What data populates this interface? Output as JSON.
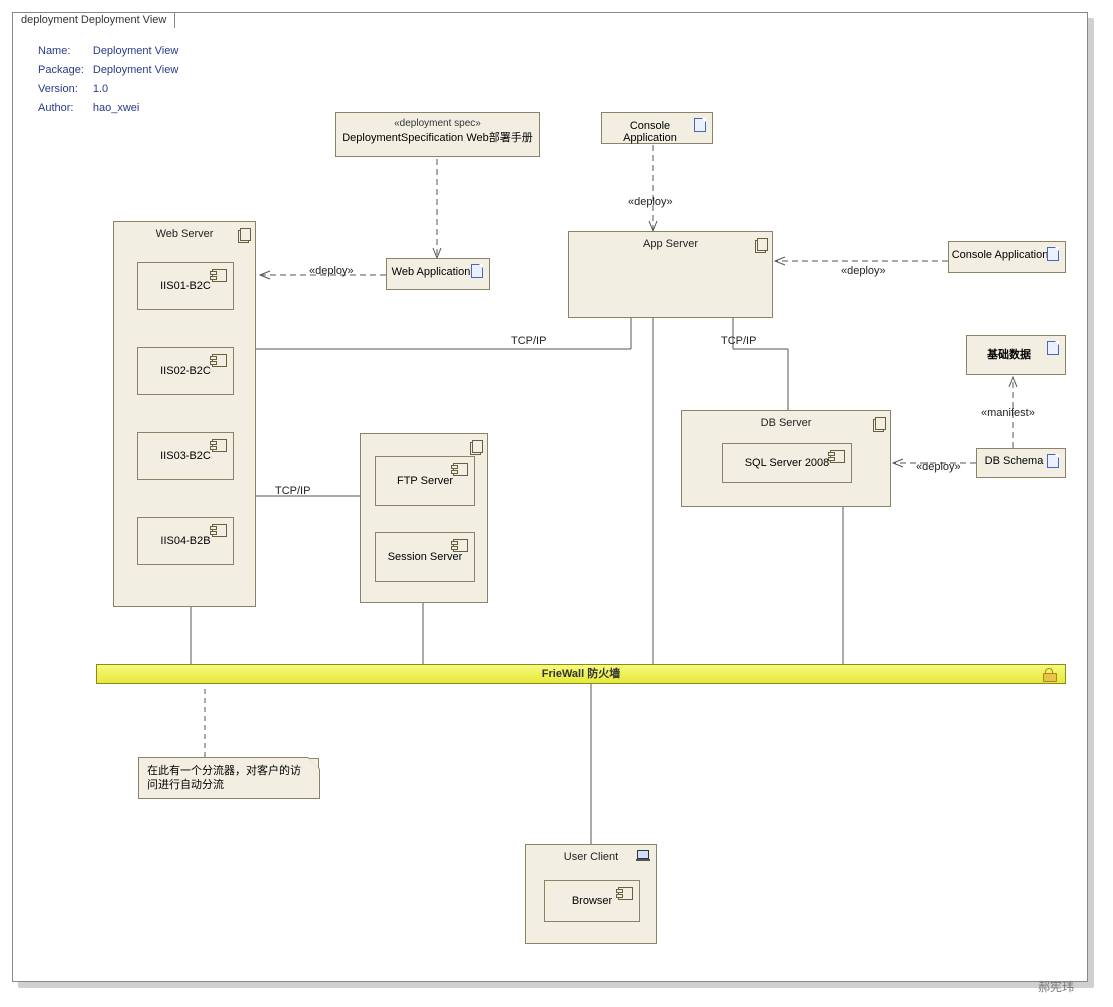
{
  "frame": {
    "tab": "deployment Deployment View"
  },
  "meta": {
    "rows": [
      {
        "k": "Name:",
        "v": "Deployment View"
      },
      {
        "k": "Package:",
        "v": "Deployment View"
      },
      {
        "k": "Version:",
        "v": "1.0"
      },
      {
        "k": "Author:",
        "v": "hao_xwei"
      }
    ]
  },
  "nodes": {
    "webServer": {
      "title": "Web Server",
      "inner": [
        "IIS01-B2C",
        "IIS02-B2C",
        "IIS03-B2C",
        "IIS04-B2B"
      ]
    },
    "appServer": {
      "title": "App Server"
    },
    "midServer": {
      "inner": [
        "FTP Server",
        "Session Server"
      ]
    },
    "dbServer": {
      "title": "DB Server",
      "inner": [
        "SQL Server 2008"
      ]
    },
    "userClient": {
      "title": "User Client",
      "inner": [
        "Browser"
      ]
    }
  },
  "artifacts": {
    "depSpec": {
      "stereo": "«deployment spec»",
      "label": "DeploymentSpecification Web部署手册"
    },
    "webApp": {
      "label": "Web Application"
    },
    "console1": {
      "label": "Console Application"
    },
    "console2": {
      "label": "Console Application"
    },
    "dbSchema": {
      "label": "DB Schema"
    },
    "baseData": {
      "label": "基础数据"
    }
  },
  "firewall": {
    "label": "FrieWall 防火墙"
  },
  "note": {
    "text": "在此有一个分流器，对客户的访问进行自动分流"
  },
  "edgeLabels": {
    "deploy": "«deploy»",
    "manifest": "«manifest»",
    "tcpip": "TCP/IP"
  },
  "author": "郝宪玮"
}
